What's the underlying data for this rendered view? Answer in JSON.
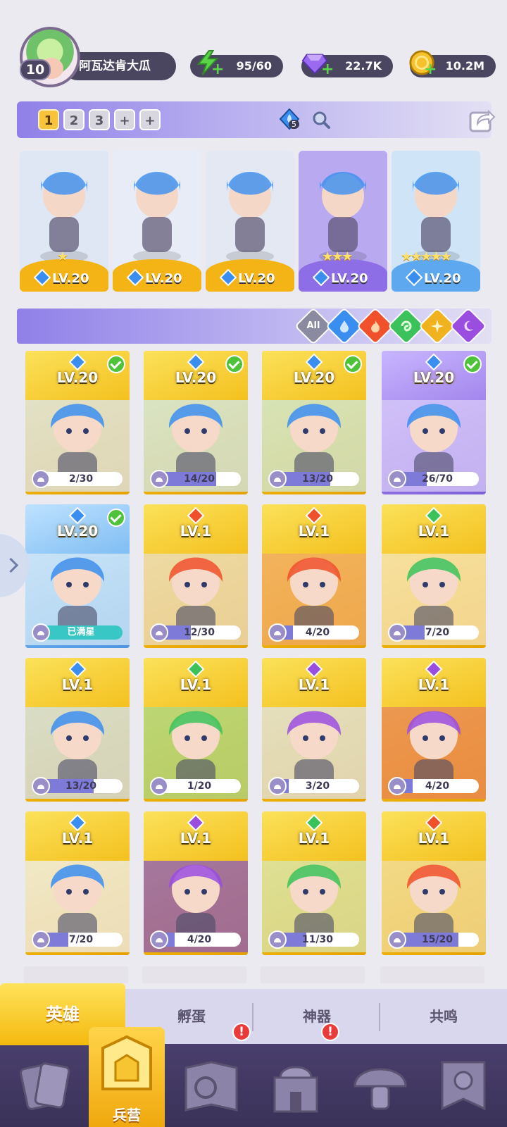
{
  "player": {
    "level": "10",
    "name": "阿瓦达肯大瓜"
  },
  "resources": {
    "energy": "95/60",
    "gems": "22.7K",
    "gold": "10.2M"
  },
  "team_tabs": [
    "1",
    "2",
    "3",
    "+",
    "+"
  ],
  "team_gem_count": "5",
  "team_heroes": [
    {
      "level": "LV.20",
      "element": "water",
      "stars": 1,
      "base": "yellow"
    },
    {
      "level": "LV.20",
      "element": "water",
      "stars": 0,
      "base": "yellow"
    },
    {
      "level": "LV.20",
      "element": "water",
      "stars": 0,
      "base": "yellow"
    },
    {
      "level": "LV.20",
      "element": "water",
      "stars": 3,
      "base": "purple"
    },
    {
      "level": "LV.20",
      "element": "water",
      "stars": 5,
      "base": "blue"
    }
  ],
  "filters": [
    "All",
    "water",
    "fire",
    "wind",
    "light",
    "dark"
  ],
  "filter_all_label": "All",
  "heroes": [
    {
      "level": "LV.20",
      "element": "water",
      "checked": true,
      "progress": "2/30",
      "fraction": 0.0667,
      "bg": "yellow"
    },
    {
      "level": "LV.20",
      "element": "water",
      "checked": true,
      "progress": "14/20",
      "fraction": 0.7,
      "bg": "yellow"
    },
    {
      "level": "LV.20",
      "element": "water",
      "checked": true,
      "progress": "13/20",
      "fraction": 0.65,
      "bg": "yellow"
    },
    {
      "level": "LV.20",
      "element": "water",
      "checked": true,
      "progress": "26/70",
      "fraction": 0.371,
      "bg": "purple"
    },
    {
      "level": "LV.20",
      "element": "water",
      "checked": true,
      "progress": "已满星",
      "fraction": 1,
      "bg": "blue",
      "maxed": true
    },
    {
      "level": "LV.1",
      "element": "fire",
      "checked": false,
      "progress": "12/30",
      "fraction": 0.4,
      "bg": "yellow"
    },
    {
      "level": "LV.1",
      "element": "fire",
      "checked": false,
      "progress": "4/20",
      "fraction": 0.2,
      "bg": "yellow"
    },
    {
      "level": "LV.1",
      "element": "wind",
      "checked": false,
      "progress": "7/20",
      "fraction": 0.35,
      "bg": "yellow"
    },
    {
      "level": "LV.1",
      "element": "water",
      "checked": false,
      "progress": "13/20",
      "fraction": 0.65,
      "bg": "yellow"
    },
    {
      "level": "LV.1",
      "element": "wind",
      "checked": false,
      "progress": "1/20",
      "fraction": 0.05,
      "bg": "yellow"
    },
    {
      "level": "LV.1",
      "element": "dark",
      "checked": false,
      "progress": "3/20",
      "fraction": 0.15,
      "bg": "yellow"
    },
    {
      "level": "LV.1",
      "element": "dark",
      "checked": false,
      "progress": "4/20",
      "fraction": 0.2,
      "bg": "yellow"
    },
    {
      "level": "LV.1",
      "element": "water",
      "checked": false,
      "progress": "7/20",
      "fraction": 0.35,
      "bg": "yellow"
    },
    {
      "level": "LV.1",
      "element": "dark",
      "checked": false,
      "progress": "4/20",
      "fraction": 0.2,
      "bg": "yellow"
    },
    {
      "level": "LV.1",
      "element": "wind",
      "checked": false,
      "progress": "11/30",
      "fraction": 0.367,
      "bg": "yellow"
    },
    {
      "level": "LV.1",
      "element": "fire",
      "checked": false,
      "progress": "15/20",
      "fraction": 0.75,
      "bg": "yellow"
    }
  ],
  "sub_tabs": [
    "英雄",
    "孵蛋",
    "神器",
    "共鸣"
  ],
  "bottom_nav": {
    "active_label": "兵营",
    "items": [
      "cards-icon",
      "barracks-icon",
      "map-icon",
      "castle-icon",
      "mushroom-icon",
      "banner-icon"
    ],
    "alerts": [
      "!",
      "!"
    ]
  },
  "colors": {
    "water": "#3a8ef0",
    "fire": "#f0502a",
    "wind": "#3cc25a",
    "light": "#f0b21e",
    "dark": "#9a4ee0",
    "card_yellow": "#f4c61c",
    "card_purple": "#9a7ae8",
    "card_blue": "#6fb4f0"
  }
}
